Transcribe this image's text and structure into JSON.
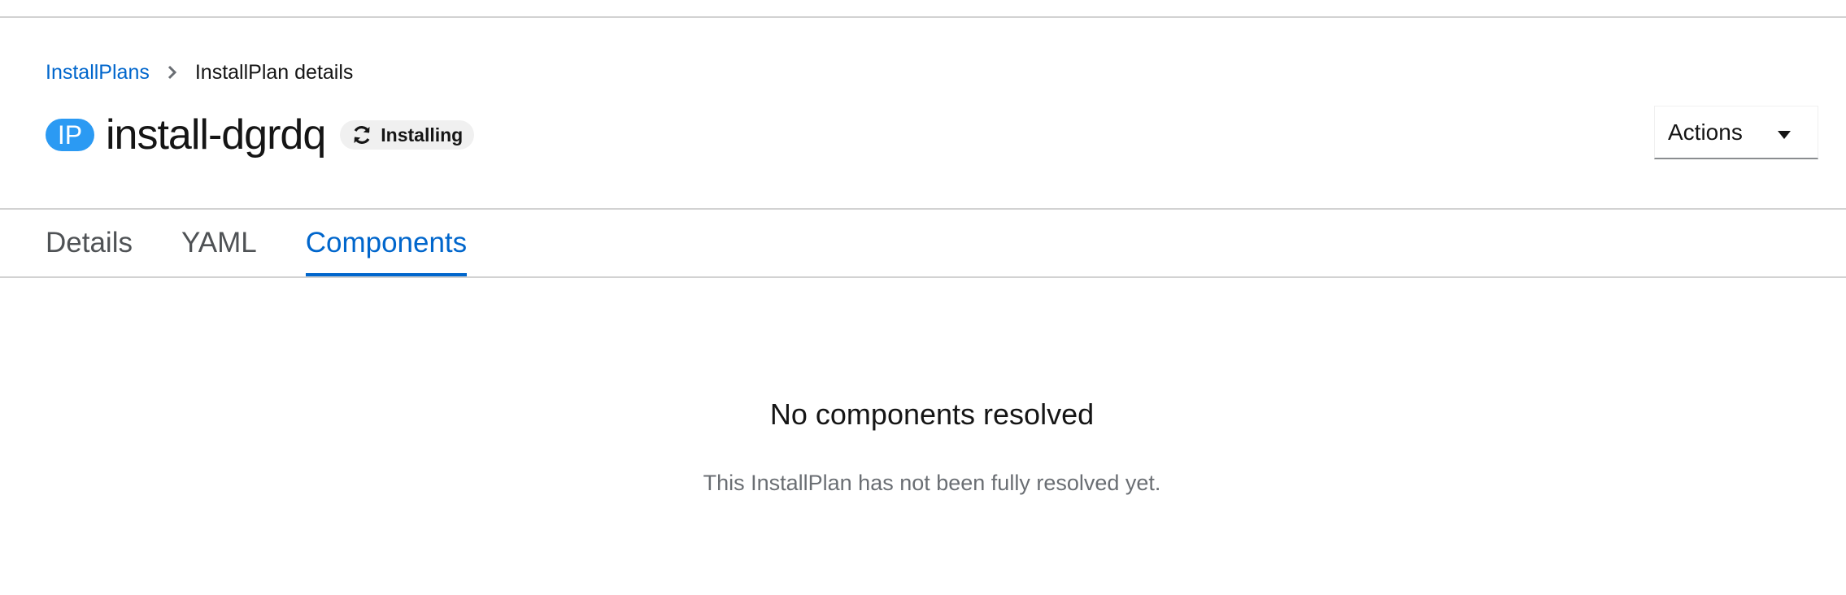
{
  "breadcrumb": {
    "parent_label": "InstallPlans",
    "current_label": "InstallPlan details"
  },
  "header": {
    "resource_badge": "IP",
    "title": "install-dgrdq",
    "status": {
      "label": "Installing",
      "icon": "sync-icon"
    }
  },
  "actions": {
    "label": "Actions",
    "icon": "caret-down-icon"
  },
  "tabs": [
    {
      "label": "Details",
      "active": false
    },
    {
      "label": "YAML",
      "active": false
    },
    {
      "label": "Components",
      "active": true
    }
  ],
  "empty_state": {
    "title": "No components resolved",
    "body": "This InstallPlan has not been fully resolved yet."
  },
  "colors": {
    "link": "#0066cc",
    "badge": "#2b9af3",
    "divider": "#d2d2d2"
  }
}
